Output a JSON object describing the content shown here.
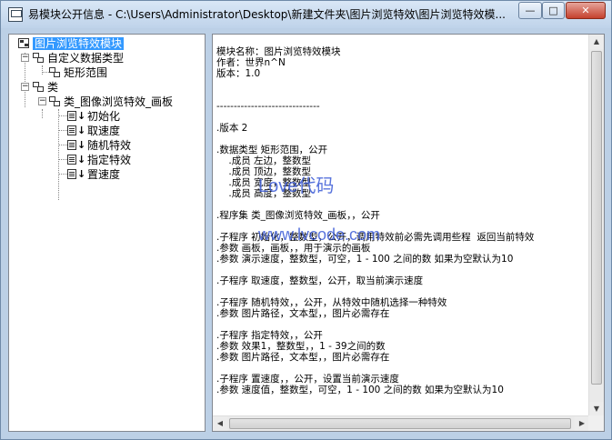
{
  "window": {
    "title": "易模块公开信息 - C:\\Users\\Administrator\\Desktop\\新建文件夹\\图片浏览特效\\图片浏览特效模...",
    "min_label": "—",
    "max_label": "□",
    "close_label": "✕"
  },
  "tree": {
    "root": "图片浏览特效模块",
    "custom_types": "自定义数据类型",
    "rect": "矩形范围",
    "class_group": "类",
    "class_name": "类_图像浏览特效_画板",
    "methods": [
      "初始化",
      "取速度",
      "随机特效",
      "指定特效",
      "置速度"
    ]
  },
  "content": {
    "lines": [
      "模块名称：图片浏览特效模块",
      "作者：世界n^N",
      "版本：1.0",
      "",
      "",
      "------------------------------",
      "",
      ".版本 2",
      "",
      ".数据类型 矩形范围，公开",
      "    .成员 左边，整数型",
      "    .成员 顶边，整数型",
      "    .成员 宽度，整数型",
      "    .成员 高度，整数型",
      "",
      ".程序集 类_图像浏览特效_画板，，公开",
      "",
      ".子程序 初始化，整数型，公开，调用特效前必需先调用些程  返回当前特效",
      ".参数 画板，画板，，用于演示的画板",
      ".参数 演示速度，整数型，可空，1 - 100 之间的数 如果为空默认为10",
      "",
      ".子程序 取速度，整数型，公开，取当前演示速度",
      "",
      ".子程序 随机特效，，公开，从特效中随机选择一种特效",
      ".参数 图片路径，文本型，，图片必需存在",
      "",
      ".子程序 指定特效，，公开",
      ".参数 效果1，整数型，，1 - 39之间的数",
      ".参数 图片路径，文本型，，图片必需存在",
      "",
      ".子程序 置速度，，公开，设置当前演示速度",
      ".参数 速度值，整数型，可空，1 - 100 之间的数 如果为空默认为10"
    ]
  },
  "watermark": {
    "brand": "Love代码",
    "url": "www.lvcode.com"
  }
}
